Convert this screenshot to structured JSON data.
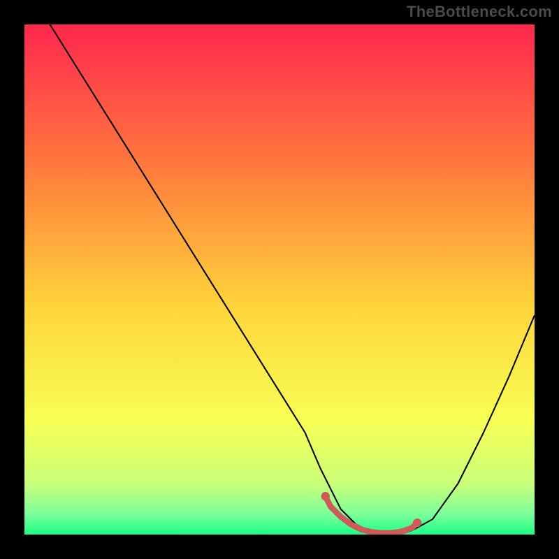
{
  "watermark": "TheBottleneck.com",
  "palette": {
    "background": "#000000",
    "gradient_top": "#ff274f",
    "gradient_upper": "#ff7a3d",
    "gradient_mid": "#ffd43a",
    "gradient_lower": "#f7ff55",
    "gradient_green1": "#caff7a",
    "gradient_green2": "#7cff9a",
    "gradient_bottom": "#1aff86",
    "curve_stroke": "#000000",
    "marker_stroke": "#cf5a5a",
    "marker_fill": "#cf5a5a"
  },
  "chart_data": {
    "type": "line",
    "title": "",
    "xlabel": "",
    "ylabel": "",
    "x_range": [
      0,
      100
    ],
    "y_range": [
      0,
      100
    ],
    "curve": {
      "name": "bottleneck-curve",
      "x": [
        5,
        10,
        15,
        20,
        25,
        30,
        35,
        40,
        45,
        50,
        55,
        58,
        60,
        62,
        65,
        68,
        70,
        72,
        74,
        76,
        80,
        85,
        90,
        95,
        100
      ],
      "y": [
        100,
        92,
        84,
        76,
        68,
        60,
        52,
        44,
        36,
        28,
        20,
        13,
        9,
        5,
        2,
        0.5,
        0,
        0,
        0.2,
        0.8,
        3,
        10,
        20,
        31,
        43
      ]
    },
    "marker_segment": {
      "name": "optimal-range",
      "x": [
        59,
        60,
        62,
        64,
        66,
        68,
        70,
        72,
        74,
        76,
        77
      ],
      "y": [
        7.5,
        5.5,
        3.5,
        2,
        1,
        0.5,
        0.3,
        0.3,
        0.6,
        1.3,
        2.3
      ]
    },
    "marker_endpoints": [
      {
        "x": 59,
        "y": 7.5
      },
      {
        "x": 77,
        "y": 2.3
      }
    ]
  }
}
